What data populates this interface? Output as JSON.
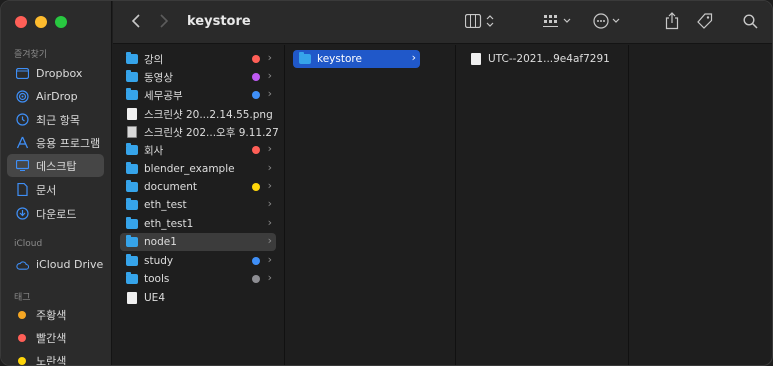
{
  "window": {
    "title": "keystore"
  },
  "sidebar": {
    "favorites_label": "즐겨찾기",
    "icloud_label": "iCloud",
    "tags_label": "태그",
    "favorites": [
      {
        "label": "Dropbox",
        "icon": "dropbox-icon"
      },
      {
        "label": "AirDrop",
        "icon": "airdrop-icon"
      },
      {
        "label": "최근 항목",
        "icon": "clock-icon"
      },
      {
        "label": "응용 프로그램",
        "icon": "applications-icon"
      },
      {
        "label": "데스크탑",
        "icon": "desktop-icon"
      },
      {
        "label": "문서",
        "icon": "document-icon"
      },
      {
        "label": "다운로드",
        "icon": "download-icon"
      }
    ],
    "icloud": [
      {
        "label": "iCloud Drive",
        "icon": "cloud-icon"
      }
    ],
    "tags": [
      {
        "label": "주황색",
        "color": "#f5a623"
      },
      {
        "label": "빨간색",
        "color": "#ff5f57"
      },
      {
        "label": "노란색",
        "color": "#ffd60a"
      }
    ]
  },
  "column1": [
    {
      "name": "강의",
      "type": "folder",
      "tag": "#ff5f57",
      "has_children": true
    },
    {
      "name": "동영상",
      "type": "folder",
      "tag": "#bf5af2",
      "has_children": true
    },
    {
      "name": "세무공부",
      "type": "folder",
      "tag": "#3f8ff7",
      "has_children": true
    },
    {
      "name": "스크린샷 20...2.14.55.png",
      "type": "file",
      "has_children": false
    },
    {
      "name": "스크린샷 202...오후 9.11.27",
      "type": "image",
      "has_children": false
    },
    {
      "name": "회사",
      "type": "folder",
      "tag": "#ff5f57",
      "has_children": true
    },
    {
      "name": "blender_example",
      "type": "folder",
      "has_children": true
    },
    {
      "name": "document",
      "type": "folder",
      "tag": "#ffd60a",
      "has_children": true
    },
    {
      "name": "eth_test",
      "type": "folder",
      "has_children": true
    },
    {
      "name": "eth_test1",
      "type": "folder",
      "has_children": true
    },
    {
      "name": "node1",
      "type": "folder",
      "has_children": true,
      "selected": "inactive"
    },
    {
      "name": "study",
      "type": "folder",
      "tag": "#3f8ff7",
      "has_children": true
    },
    {
      "name": "tools",
      "type": "folder",
      "tag": "#8e8e93",
      "has_children": true
    },
    {
      "name": "UE4",
      "type": "file",
      "has_children": false
    }
  ],
  "column2": [
    {
      "name": "keystore",
      "type": "folder",
      "has_children": true,
      "selected": "active"
    }
  ],
  "column3": [
    {
      "name": "UTC--2021...9e4af7291",
      "type": "file",
      "has_children": false
    }
  ]
}
